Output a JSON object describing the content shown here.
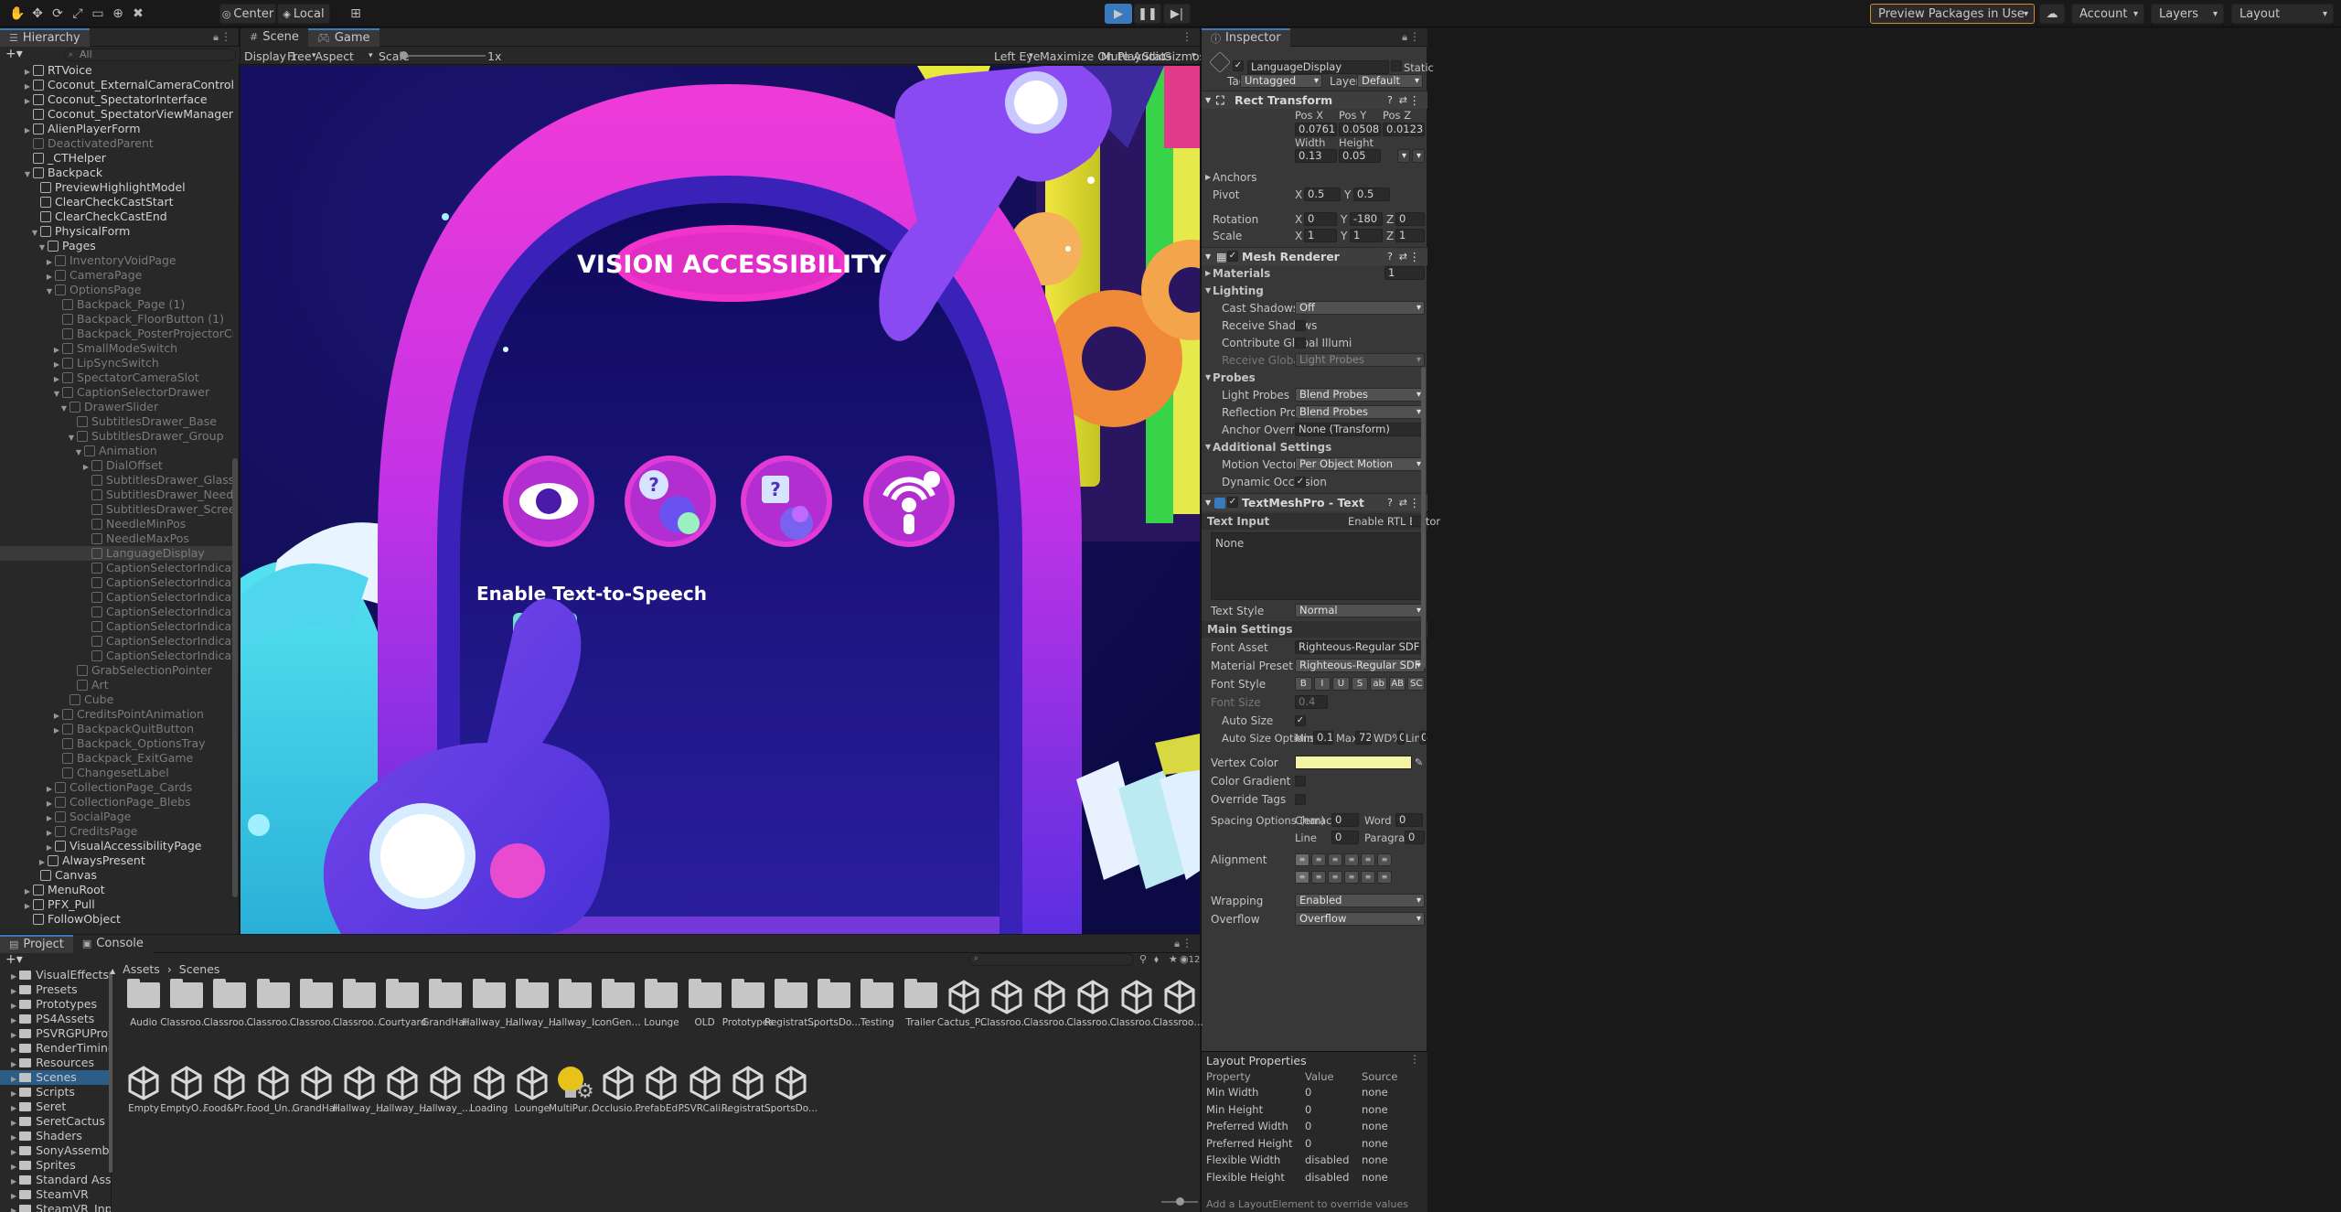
{
  "toolbar": {
    "center_label": "Center",
    "local_label": "Local",
    "preview_packages": "Preview Packages in Use",
    "account": "Account",
    "layers": "Layers",
    "layout": "Layout"
  },
  "hierarchy": {
    "tab": "Hierarchy",
    "search_placeholder": "All",
    "items": [
      {
        "label": "RTVoice",
        "depth": 2,
        "arrow": "▶",
        "dim": false
      },
      {
        "label": "Coconut_ExternalCameraController",
        "depth": 2,
        "arrow": "▶",
        "dim": false
      },
      {
        "label": "Coconut_SpectatorInterface",
        "depth": 2,
        "arrow": "▶",
        "dim": false
      },
      {
        "label": "Coconut_SpectatorViewManager",
        "depth": 2,
        "arrow": "",
        "dim": false
      },
      {
        "label": "AlienPlayerForm",
        "depth": 2,
        "arrow": "▶",
        "dim": false
      },
      {
        "label": "DeactivatedParent",
        "depth": 2,
        "arrow": "",
        "dim": true
      },
      {
        "label": "_CTHelper",
        "depth": 2,
        "arrow": "",
        "dim": false
      },
      {
        "label": "Backpack",
        "depth": 2,
        "arrow": "▼",
        "dim": false
      },
      {
        "label": "PreviewHighlightModel",
        "depth": 3,
        "arrow": "",
        "dim": false
      },
      {
        "label": "ClearCheckCastStart",
        "depth": 3,
        "arrow": "",
        "dim": false
      },
      {
        "label": "ClearCheckCastEnd",
        "depth": 3,
        "arrow": "",
        "dim": false
      },
      {
        "label": "PhysicalForm",
        "depth": 3,
        "arrow": "▼",
        "dim": false
      },
      {
        "label": "Pages",
        "depth": 4,
        "arrow": "▼",
        "dim": false
      },
      {
        "label": "InventoryVoidPage",
        "depth": 5,
        "arrow": "▶",
        "dim": true
      },
      {
        "label": "CameraPage",
        "depth": 5,
        "arrow": "▶",
        "dim": true
      },
      {
        "label": "OptionsPage",
        "depth": 5,
        "arrow": "▼",
        "dim": true
      },
      {
        "label": "Backpack_Page (1)",
        "depth": 6,
        "arrow": "",
        "dim": true
      },
      {
        "label": "Backpack_FloorButton (1)",
        "depth": 6,
        "arrow": "",
        "dim": true
      },
      {
        "label": "Backpack_PosterProjectorCredits_Icon",
        "depth": 6,
        "arrow": "",
        "dim": true
      },
      {
        "label": "SmallModeSwitch",
        "depth": 6,
        "arrow": "▶",
        "dim": true
      },
      {
        "label": "LipSyncSwitch",
        "depth": 6,
        "arrow": "▶",
        "dim": true
      },
      {
        "label": "SpectatorCameraSlot",
        "depth": 6,
        "arrow": "▶",
        "dim": true
      },
      {
        "label": "CaptionSelectorDrawer",
        "depth": 6,
        "arrow": "▼",
        "dim": true
      },
      {
        "label": "DrawerSlider",
        "depth": 7,
        "arrow": "▼",
        "dim": true
      },
      {
        "label": "SubtitlesDrawer_Base",
        "depth": 8,
        "arrow": "",
        "dim": true
      },
      {
        "label": "SubtitlesDrawer_Group",
        "depth": 8,
        "arrow": "▼",
        "dim": true
      },
      {
        "label": "Animation",
        "depth": 9,
        "arrow": "▼",
        "dim": true
      },
      {
        "label": "DialOffset",
        "depth": 10,
        "arrow": "▶",
        "dim": true
      },
      {
        "label": "SubtitlesDrawer_Glass",
        "depth": 10,
        "arrow": "",
        "dim": true
      },
      {
        "label": "SubtitlesDrawer_Needle",
        "depth": 10,
        "arrow": "",
        "dim": true
      },
      {
        "label": "SubtitlesDrawer_Screen",
        "depth": 10,
        "arrow": "",
        "dim": true
      },
      {
        "label": "NeedleMinPos",
        "depth": 10,
        "arrow": "",
        "dim": true
      },
      {
        "label": "NeedleMaxPos",
        "depth": 10,
        "arrow": "",
        "dim": true
      },
      {
        "label": "LanguageDisplay",
        "depth": 10,
        "arrow": "",
        "dim": true,
        "sel": true
      },
      {
        "label": "CaptionSelectorIndicatorDot",
        "depth": 10,
        "arrow": "",
        "dim": true
      },
      {
        "label": "CaptionSelectorIndicatorDot",
        "depth": 10,
        "arrow": "",
        "dim": true
      },
      {
        "label": "CaptionSelectorIndicatorDot",
        "depth": 10,
        "arrow": "",
        "dim": true
      },
      {
        "label": "CaptionSelectorIndicatorDot",
        "depth": 10,
        "arrow": "",
        "dim": true
      },
      {
        "label": "CaptionSelectorIndicatorDot",
        "depth": 10,
        "arrow": "",
        "dim": true
      },
      {
        "label": "CaptionSelectorIndicatorDot",
        "depth": 10,
        "arrow": "",
        "dim": true
      },
      {
        "label": "CaptionSelectorIndicatorDot",
        "depth": 10,
        "arrow": "",
        "dim": true
      },
      {
        "label": "GrabSelectionPointer",
        "depth": 8,
        "arrow": "",
        "dim": true
      },
      {
        "label": "Art",
        "depth": 8,
        "arrow": "",
        "dim": true
      },
      {
        "label": "Cube",
        "depth": 7,
        "arrow": "",
        "dim": true
      },
      {
        "label": "CreditsPointAnimation",
        "depth": 6,
        "arrow": "▶",
        "dim": true
      },
      {
        "label": "BackpackQuitButton",
        "depth": 6,
        "arrow": "▶",
        "dim": true
      },
      {
        "label": "Backpack_OptionsTray",
        "depth": 6,
        "arrow": "",
        "dim": true
      },
      {
        "label": "Backpack_ExitGame",
        "depth": 6,
        "arrow": "",
        "dim": true
      },
      {
        "label": "ChangesetLabel",
        "depth": 6,
        "arrow": "",
        "dim": true
      },
      {
        "label": "CollectionPage_Cards",
        "depth": 5,
        "arrow": "▶",
        "dim": true
      },
      {
        "label": "CollectionPage_Blebs",
        "depth": 5,
        "arrow": "▶",
        "dim": true
      },
      {
        "label": "SocialPage",
        "depth": 5,
        "arrow": "▶",
        "dim": true
      },
      {
        "label": "CreditsPage",
        "depth": 5,
        "arrow": "▶",
        "dim": true
      },
      {
        "label": "VisualAccessibilityPage",
        "depth": 5,
        "arrow": "▶",
        "dim": false
      },
      {
        "label": "AlwaysPresent",
        "depth": 4,
        "arrow": "▶",
        "dim": false
      },
      {
        "label": "Canvas",
        "depth": 3,
        "arrow": "",
        "dim": false
      },
      {
        "label": "MenuRoot",
        "depth": 2,
        "arrow": "▶",
        "dim": false
      },
      {
        "label": "PFX_Pull",
        "depth": 2,
        "arrow": "▶",
        "dim": false
      },
      {
        "label": "FollowObject",
        "depth": 2,
        "arrow": "",
        "dim": false
      }
    ]
  },
  "game": {
    "tab_scene": "Scene",
    "tab_game": "Game",
    "display": "Display 1",
    "aspect": "Free Aspect",
    "scale_label": "Scale",
    "scale_value": "1x",
    "eye": "Left Eye",
    "maximize": "Maximize On Play",
    "mute": "Mute Audio",
    "stats": "Stats",
    "gizmos": "Gizmos",
    "sign_title": "VISION ACCESSIBILITY",
    "tts_label": "Enable Text-to-Speech"
  },
  "inspector": {
    "tab": "Inspector",
    "object_name": "LanguageDisplay",
    "static": "Static",
    "tag_label": "Tag",
    "tag_value": "Untagged",
    "layer_label": "Layer",
    "layer_value": "Default",
    "rect_transform": "Rect Transform",
    "posx_label": "Pos X",
    "posy_label": "Pos Y",
    "posz_label": "Pos Z",
    "posx": "0.0761",
    "posy": "0.0508",
    "posz": "0.01230002",
    "width_label": "Width",
    "height_label": "Height",
    "width": "0.13",
    "height": "0.05",
    "anchors": "Anchors",
    "pivot": "Pivot",
    "pivot_x": "0.5",
    "pivot_y": "0.5",
    "rotation": "Rotation",
    "rot_x": "0",
    "rot_y": "-180",
    "rot_z": "0",
    "scale": "Scale",
    "scale_x": "1",
    "scale_y": "1",
    "scale_z": "1",
    "x": "X",
    "y": "Y",
    "z": "Z",
    "mesh_renderer": "Mesh Renderer",
    "materials": "Materials",
    "materials_count": "1",
    "lighting": "Lighting",
    "cast_shadows": "Cast Shadows",
    "cast_shadows_value": "Off",
    "receive_shadows": "Receive Shadows",
    "contribute_gi": "Contribute Global Illumi",
    "receive_gi": "Receive Global Illumina",
    "receive_gi_value": "Light Probes",
    "probes": "Probes",
    "light_probes": "Light Probes",
    "light_probes_value": "Blend Probes",
    "reflection_probes": "Reflection Probes",
    "reflection_probes_value": "Blend Probes",
    "anchor_override": "Anchor Override",
    "anchor_override_value": "None (Transform)",
    "additional_settings": "Additional Settings",
    "motion_vectors": "Motion Vectors",
    "motion_vectors_value": "Per Object Motion",
    "dynamic_occlusion": "Dynamic Occlusion",
    "tmp": "TextMeshPro - Text",
    "text_input": "Text Input",
    "rtl": "Enable RTL Editor",
    "text_value": "None",
    "text_style": "Text Style",
    "text_style_value": "Normal",
    "main_settings": "Main Settings",
    "font_asset": "Font Asset",
    "font_asset_value": "Righteous-Regular SDF (TMP_Font",
    "material_preset": "Material Preset",
    "material_preset_value": "Righteous-Regular SDF Material",
    "font_style": "Font Style",
    "font_style_buttons": [
      "B",
      "I",
      "U",
      "S",
      "ab",
      "AB",
      "SC"
    ],
    "font_size": "Font Size",
    "font_size_value": "0.4",
    "auto_size": "Auto Size",
    "auto_size_options": "Auto Size Options",
    "min_label": "Min",
    "min": "0.1",
    "max_label": "Max",
    "max": "72",
    "wd_label": "WD%",
    "wd": "0",
    "line_label": "Line",
    "line": "0",
    "vertex_color": "Vertex Color",
    "vertex_color_hex": "#f3f5a4",
    "color_gradient": "Color Gradient",
    "override_tags": "Override Tags",
    "spacing": "Spacing Options (em)",
    "character": "Character",
    "character_v": "0",
    "word": "Word",
    "word_v": "0",
    "line2": "Line",
    "line2_v": "0",
    "paragraph": "Paragraph",
    "paragraph_v": "0",
    "alignment": "Alignment",
    "wrapping": "Wrapping",
    "wrapping_value": "Enabled",
    "overflow": "Overflow",
    "overflow_value": "Overflow",
    "layout_properties": "Layout Properties",
    "lp_headers": [
      "Property",
      "Value",
      "Source"
    ],
    "lp_rows": [
      [
        "Min Width",
        "0",
        "none"
      ],
      [
        "Min Height",
        "0",
        "none"
      ],
      [
        "Preferred Width",
        "0",
        "none"
      ],
      [
        "Preferred Height",
        "0",
        "none"
      ],
      [
        "Flexible Width",
        "disabled",
        "none"
      ],
      [
        "Flexible Height",
        "disabled",
        "none"
      ]
    ],
    "lp_footer": "Add a LayoutElement to override values"
  },
  "project": {
    "tab_project": "Project",
    "tab_console": "Console",
    "breadcrumb_root": "Assets",
    "breadcrumb_sep": "›",
    "breadcrumb_current": "Scenes",
    "hidden_count": "12",
    "tree": [
      {
        "label": "VisualEffects",
        "sel": false
      },
      {
        "label": "Presets",
        "sel": false
      },
      {
        "label": "Prototypes",
        "sel": false
      },
      {
        "label": "PS4Assets",
        "sel": false
      },
      {
        "label": "PSVRGPUProfiling",
        "sel": false
      },
      {
        "label": "RenderTiming",
        "sel": false
      },
      {
        "label": "Resources",
        "sel": false
      },
      {
        "label": "Scenes",
        "sel": true
      },
      {
        "label": "Scripts",
        "sel": false
      },
      {
        "label": "Seret",
        "sel": false
      },
      {
        "label": "SeretCactus",
        "sel": false
      },
      {
        "label": "Shaders",
        "sel": false
      },
      {
        "label": "SonyAssemblies",
        "sel": false
      },
      {
        "label": "Sprites",
        "sel": false
      },
      {
        "label": "Standard Assets",
        "sel": false
      },
      {
        "label": "SteamVR",
        "sel": false
      },
      {
        "label": "SteamVR_Input",
        "sel": false
      }
    ],
    "assets_row1": [
      {
        "label": "Audio",
        "type": "folder"
      },
      {
        "label": "Classroom...",
        "type": "folder"
      },
      {
        "label": "Classroom...",
        "type": "folder"
      },
      {
        "label": "Classroom...",
        "type": "folder"
      },
      {
        "label": "Classroom...",
        "type": "folder"
      },
      {
        "label": "Classroom...",
        "type": "folder"
      },
      {
        "label": "Courtyard",
        "type": "folder"
      },
      {
        "label": "GrandHall",
        "type": "folder"
      },
      {
        "label": "Hallway_C...",
        "type": "folder"
      },
      {
        "label": "Hallway_Li...",
        "type": "folder"
      },
      {
        "label": "Hallway_M...",
        "type": "folder"
      },
      {
        "label": "IconGener...",
        "type": "folder"
      },
      {
        "label": "Lounge",
        "type": "folder"
      },
      {
        "label": "OLD",
        "type": "folder"
      },
      {
        "label": "Prototypes",
        "type": "folder"
      },
      {
        "label": "Registration",
        "type": "folder"
      },
      {
        "label": "SportsDo...",
        "type": "folder"
      },
      {
        "label": "Testing",
        "type": "folder"
      },
      {
        "label": "Trailer",
        "type": "folder"
      },
      {
        "label": "Cactus_Pr...",
        "type": "unity"
      },
      {
        "label": "Classroom...",
        "type": "unity"
      },
      {
        "label": "Classroom...",
        "type": "unity"
      },
      {
        "label": "Classroom...",
        "type": "unity"
      },
      {
        "label": "Classroom...",
        "type": "unity"
      },
      {
        "label": "Classroom...",
        "type": "unity"
      }
    ],
    "assets_row2": [
      {
        "label": "Empty",
        "type": "unity"
      },
      {
        "label": "EmptyOcc...",
        "type": "unity"
      },
      {
        "label": "Food&Props",
        "type": "unity"
      },
      {
        "label": "Food_Unp...",
        "type": "unity"
      },
      {
        "label": "GrandHall",
        "type": "unity"
      },
      {
        "label": "Hallway_C...",
        "type": "unity"
      },
      {
        "label": "Hallway_Li...",
        "type": "unity"
      },
      {
        "label": "Hallway_M...",
        "type": "unity"
      },
      {
        "label": "Loading",
        "type": "unity"
      },
      {
        "label": "Lounge",
        "type": "unity"
      },
      {
        "label": "MultiPurpo...",
        "type": "lighting"
      },
      {
        "label": "Occlusion...",
        "type": "unity"
      },
      {
        "label": "PrefabEditi...",
        "type": "unity"
      },
      {
        "label": "PSVRCalibr...",
        "type": "unity"
      },
      {
        "label": "Registration",
        "type": "unity"
      },
      {
        "label": "SportsDo...",
        "type": "unity"
      }
    ]
  }
}
